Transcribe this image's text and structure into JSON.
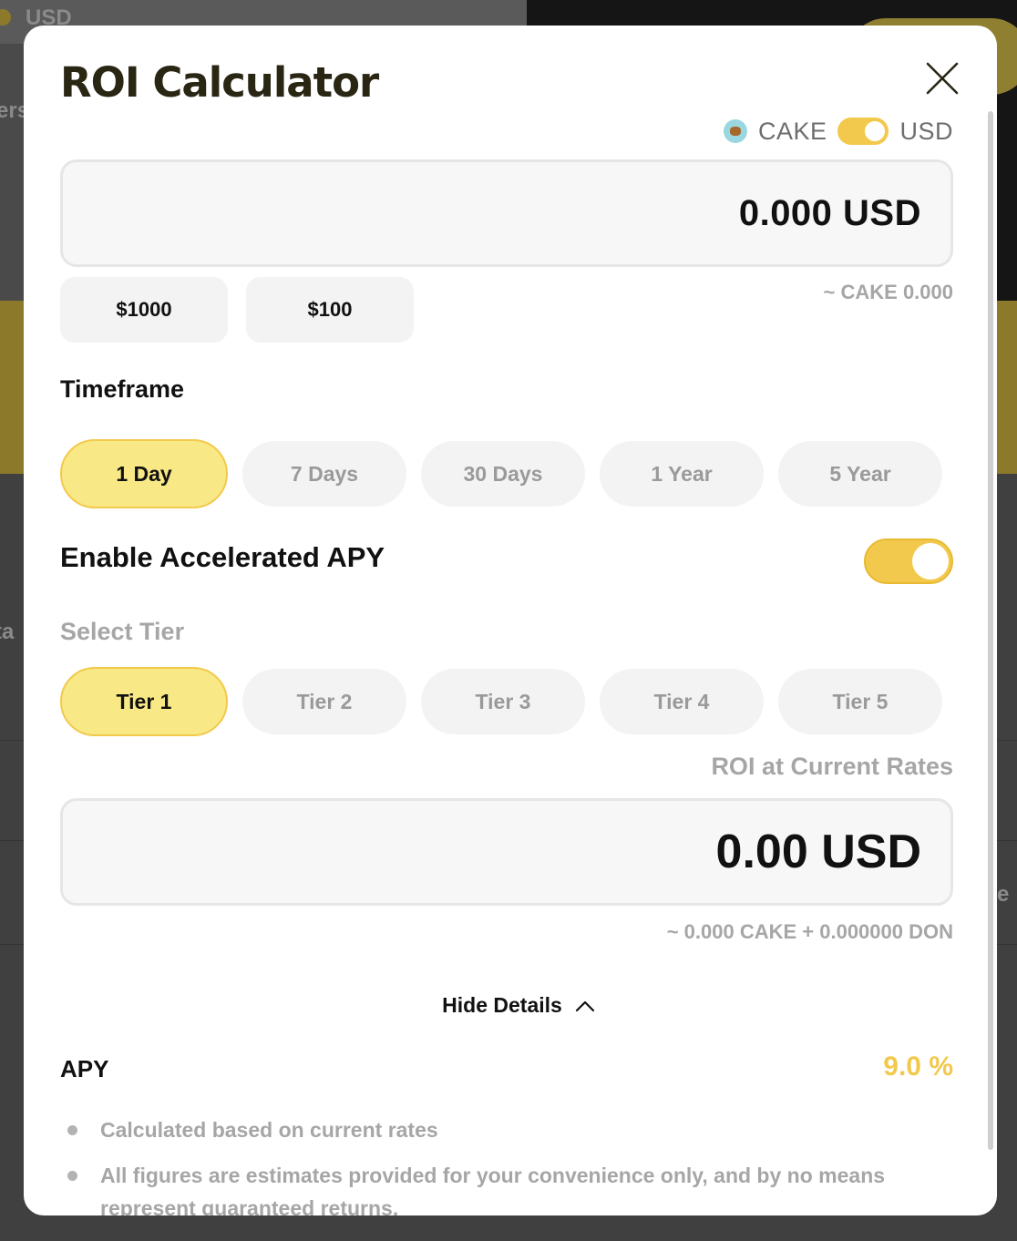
{
  "background": {
    "partial_texts": [
      "USD",
      "ers",
      "ta",
      "e"
    ]
  },
  "modal": {
    "title": "ROI Calculator",
    "close_icon": "close-icon"
  },
  "currency_toggle": {
    "left_label": "CAKE",
    "right_label": "USD",
    "selected": "USD",
    "icon": "cake-token-icon"
  },
  "amount_input": {
    "value": "0.000 USD",
    "equivalent": "~ CAKE 0.000"
  },
  "quick_amounts": [
    "$1000",
    "$100"
  ],
  "timeframe": {
    "label": "Timeframe",
    "options": [
      "1 Day",
      "7 Days",
      "30 Days",
      "1 Year",
      "5 Year"
    ],
    "selected": "1 Day"
  },
  "accelerated_apy": {
    "label": "Enable Accelerated APY",
    "enabled": true
  },
  "tier": {
    "label": "Select Tier",
    "options": [
      "Tier 1",
      "Tier 2",
      "Tier 3",
      "Tier 4",
      "Tier 5"
    ],
    "selected": "Tier 1"
  },
  "roi": {
    "label": "ROI at Current Rates",
    "value": "0.00 USD",
    "equivalent": "~ 0.000 CAKE + 0.000000 DON"
  },
  "details": {
    "toggle_label": "Hide Details",
    "toggle_icon": "chevron-up-icon",
    "apy_label": "APY",
    "apy_value": "9.0 %",
    "notes": [
      "Calculated based on current rates",
      "All figures are estimates provided for your convenience only, and by no means represent guaranteed returns."
    ]
  },
  "colors": {
    "accent": "#f2c94c",
    "active_pill": "#f8e886",
    "title": "#2a2614",
    "muted": "#a6a6a6"
  }
}
